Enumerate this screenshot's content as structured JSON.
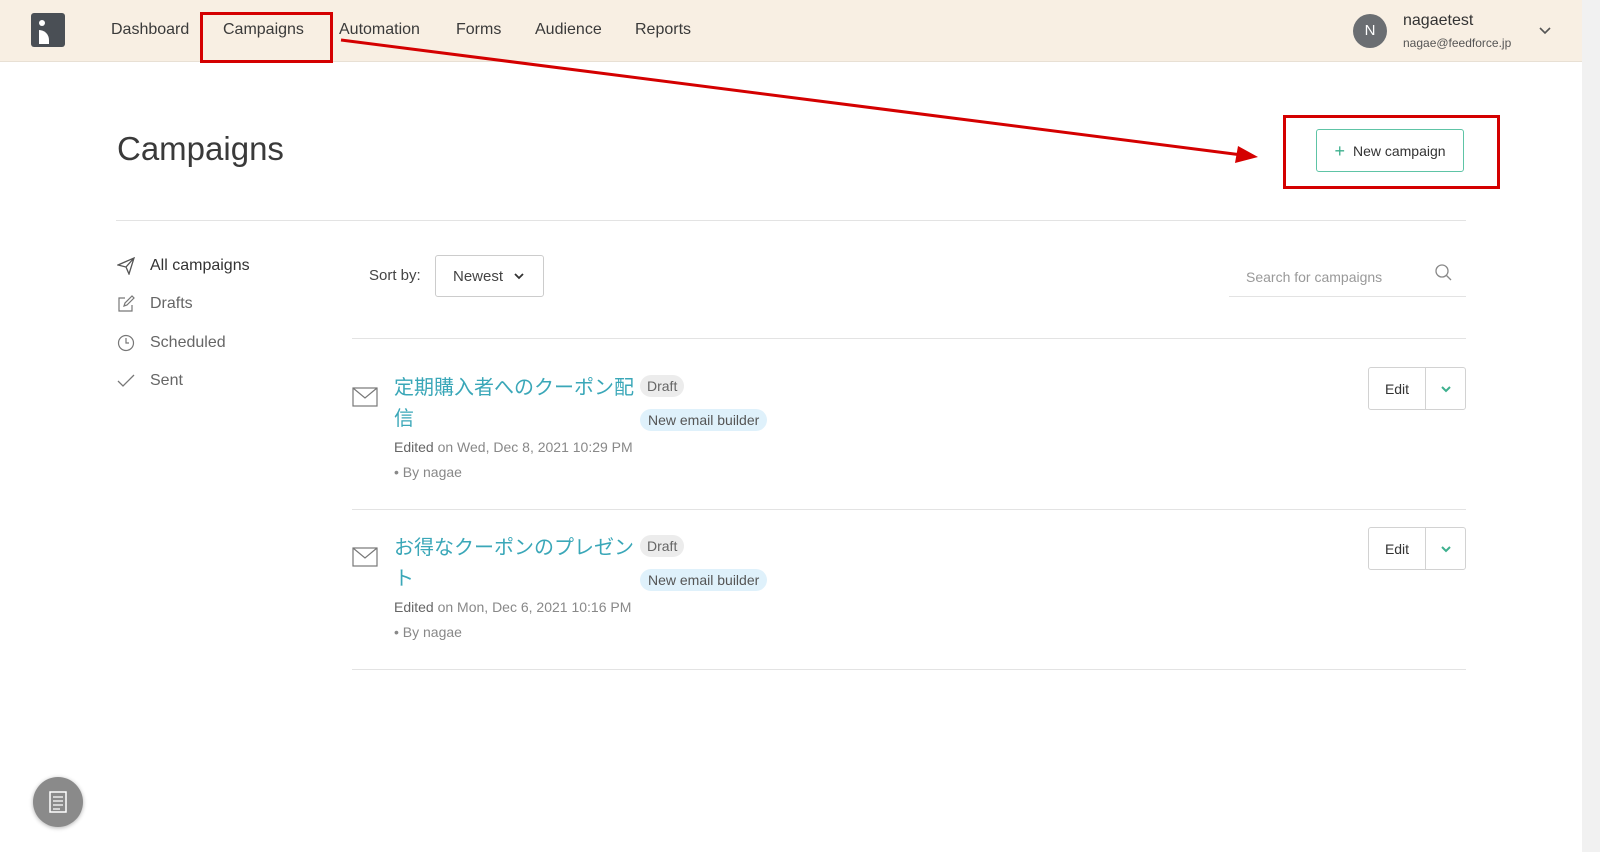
{
  "nav": {
    "items": [
      {
        "label": "Dashboard"
      },
      {
        "label": "Campaigns"
      },
      {
        "label": "Automation"
      },
      {
        "label": "Forms"
      },
      {
        "label": "Audience"
      },
      {
        "label": "Reports"
      }
    ],
    "user": {
      "initial": "N",
      "name": "nagaetest",
      "email": "nagae@feedforce.jp"
    }
  },
  "page": {
    "title": "Campaigns",
    "new_button": "New campaign"
  },
  "sidebar": {
    "items": [
      {
        "label": "All campaigns",
        "icon": "paper-plane-icon"
      },
      {
        "label": "Drafts",
        "icon": "pencil-square-icon"
      },
      {
        "label": "Scheduled",
        "icon": "clock-icon"
      },
      {
        "label": "Sent",
        "icon": "check-icon"
      }
    ]
  },
  "toolbar": {
    "sort_label": "Sort by:",
    "sort_value": "Newest",
    "search_placeholder": "Search for campaigns"
  },
  "campaigns": [
    {
      "title": "定期購入者へのクーポン配信",
      "status": "Draft",
      "builder": "New email builder",
      "edited_prefix": "Edited",
      "edited_date": "on Wed, Dec 8, 2021 10:29 PM",
      "by": "• By nagae",
      "edit_label": "Edit"
    },
    {
      "title": "お得なクーポンのプレゼント",
      "status": "Draft",
      "builder": "New email builder",
      "edited_prefix": "Edited",
      "edited_date": "on Mon, Dec 6, 2021 10:16 PM",
      "by": "• By nagae",
      "edit_label": "Edit"
    }
  ],
  "colors": {
    "accent": "#3aa7b8",
    "button_border": "#5ec4a6",
    "annotation": "#d40000",
    "topbar": "#f8efe3"
  }
}
